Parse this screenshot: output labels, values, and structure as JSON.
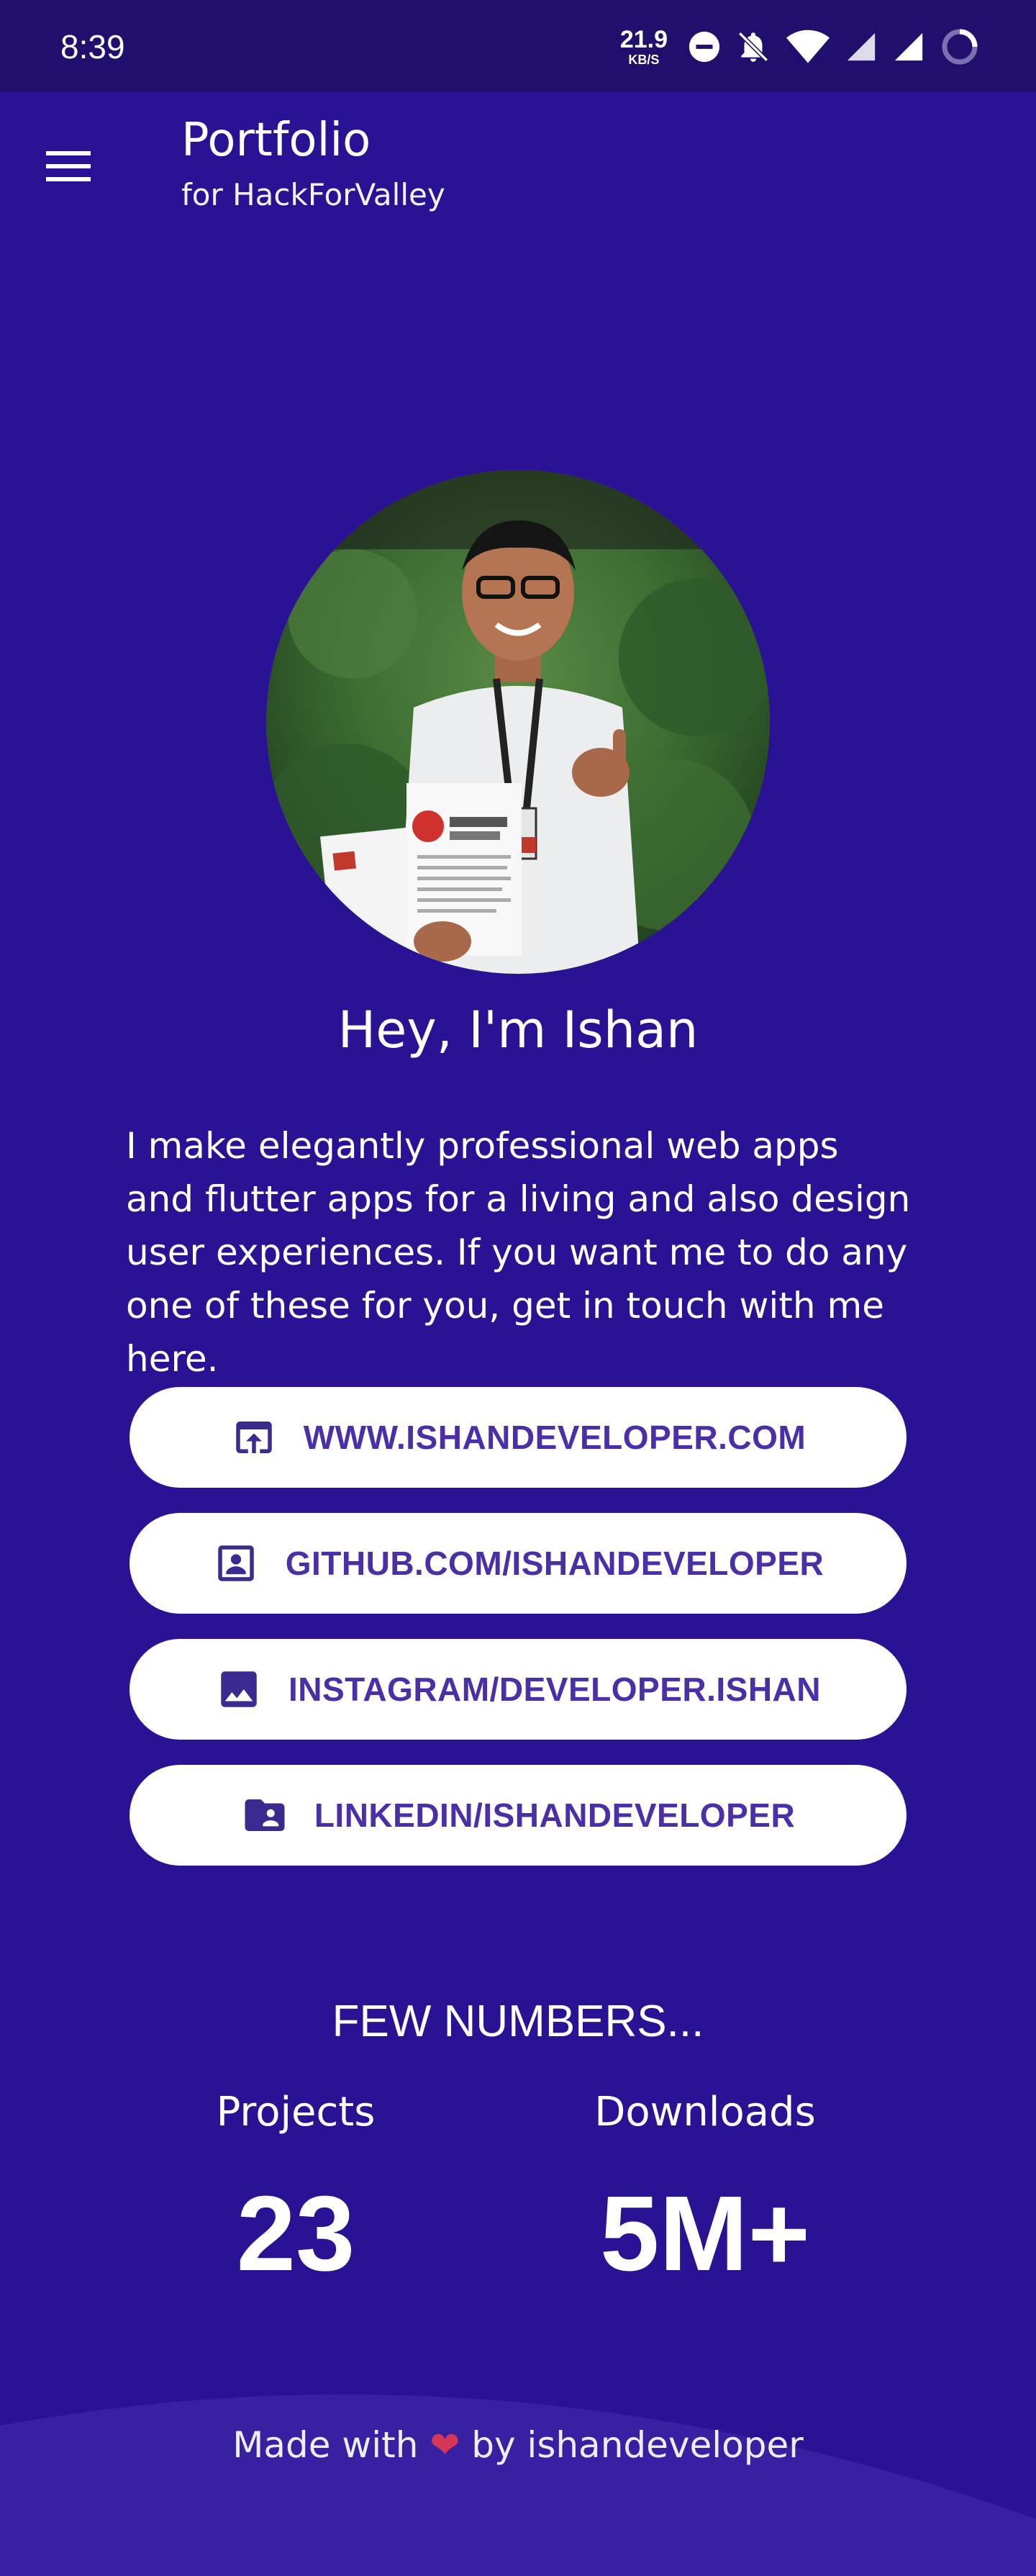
{
  "status_bar": {
    "time": "8:39",
    "net_speed_value": "21.9",
    "net_speed_unit": "KB/S",
    "icons": [
      "do-not-disturb-icon",
      "bell-off-icon",
      "wifi-icon",
      "signal-icon",
      "signal-icon",
      "battery-charging-icon"
    ]
  },
  "app_bar": {
    "title": "Portfolio",
    "subtitle": "for HackForValley",
    "menu_icon": "hamburger-menu-icon"
  },
  "profile": {
    "greeting": "Hey, I'm Ishan",
    "bio": "I make elegantly professional web apps and flutter apps for a living and also design user experiences. If you want me to do any one of these for you, get in touch with me here."
  },
  "links": [
    {
      "label": "WWW.ISHANDEVELOPER.COM",
      "icon": "open-in-browser-icon"
    },
    {
      "label": "GITHUB.COM/ISHANDEVELOPER",
      "icon": "portrait-icon"
    },
    {
      "label": "INSTAGRAM/DEVELOPER.ISHAN",
      "icon": "image-icon"
    },
    {
      "label": "LINKEDIN/ISHANDEVELOPER",
      "icon": "folder-shared-icon"
    }
  ],
  "numbers": {
    "title": "FEW NUMBERS...",
    "stats": [
      {
        "label": "Projects",
        "value": "23"
      },
      {
        "label": "Downloads",
        "value": "5M+"
      }
    ]
  },
  "footer": {
    "prefix": "Made with",
    "heart": "❤",
    "suffix": "by ishandeveloper"
  },
  "colors": {
    "background": "#2b1294",
    "status_bar": "#220e6c",
    "button_bg": "#ffffff",
    "button_text": "#4a2fa8",
    "heart": "#e53950"
  }
}
